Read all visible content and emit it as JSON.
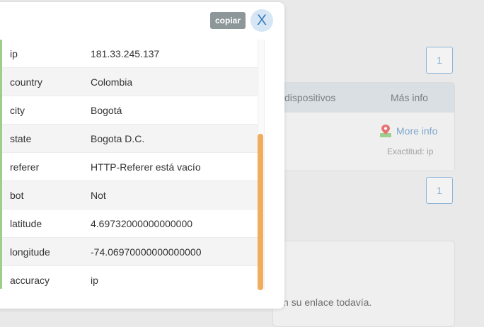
{
  "background": {
    "page_number_top": "1",
    "page_number_bottom": "1",
    "card": {
      "col_devices": "dispositivos",
      "col_more_info": "Más info",
      "more_info_link": "More info",
      "accuracy_note": "Exactitud: ip"
    },
    "bottom_text": "n su enlace todavía."
  },
  "modal": {
    "copy_label": "copiar",
    "close_label": "X",
    "rows": [
      {
        "key": "ip",
        "value": "181.33.245.137"
      },
      {
        "key": "country",
        "value": "Colombia"
      },
      {
        "key": "city",
        "value": "Bogotá"
      },
      {
        "key": "state",
        "value": "Bogota D.C."
      },
      {
        "key": "referer",
        "value": "HTTP-Referer está vacío"
      },
      {
        "key": "bot",
        "value": "Not"
      },
      {
        "key": "latitude",
        "value": "4.69732000000000000"
      },
      {
        "key": "longitude",
        "value": "-74.06970000000000000"
      },
      {
        "key": "accuracy",
        "value": "ip"
      }
    ]
  },
  "colors": {
    "accent": "#3a7cbf",
    "scroll_thumb": "#f0ad5e",
    "copy_button": "#8d9799"
  }
}
